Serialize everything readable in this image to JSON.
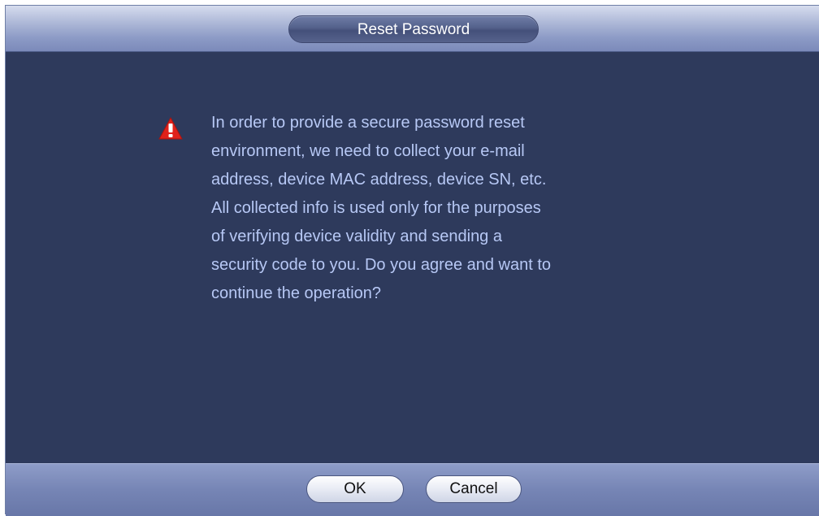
{
  "dialog": {
    "title": "Reset Password",
    "icon": "warning-icon",
    "message_lines": [
      "In order to provide a secure password reset",
      "environment, we need to collect your e-mail",
      "address, device MAC address, device SN, etc.",
      "All collected info is used only for the purposes",
      "of verifying device validity and sending a",
      "security code to you. Do you agree and want to",
      "continue the operation?"
    ],
    "ok_label": "OK",
    "cancel_label": "Cancel"
  },
  "colors": {
    "background": "#2e3a5c",
    "text": "#b7c8f5",
    "warning": "#e0211b"
  }
}
